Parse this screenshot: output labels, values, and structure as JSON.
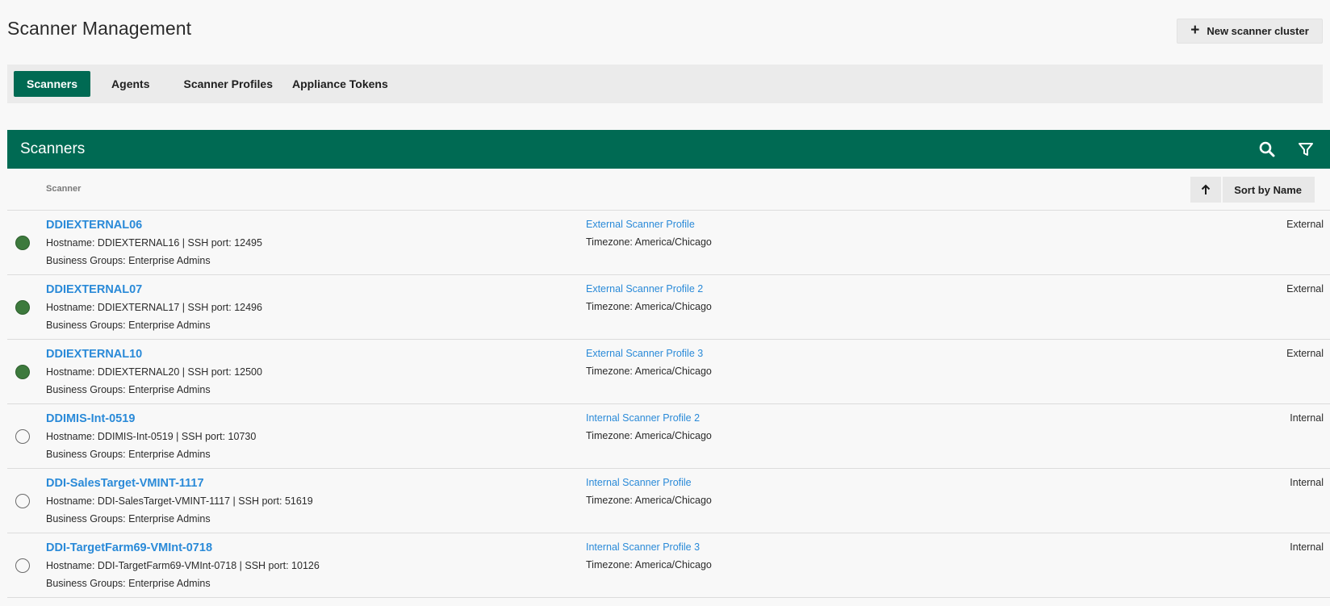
{
  "header": {
    "title": "Scanner Management",
    "new_cluster_label": "New scanner cluster"
  },
  "tabs": [
    {
      "label": "Scanners",
      "active": true
    },
    {
      "label": "Agents",
      "active": false
    },
    {
      "label": "Scanner Profiles",
      "active": false
    },
    {
      "label": "Appliance Tokens",
      "active": false
    }
  ],
  "panel": {
    "title": "Scanners",
    "column_label": "Scanner",
    "sort_label": "Sort by Name",
    "sort_direction": "ascending"
  },
  "colors": {
    "brand_green": "#006a53",
    "link_blue": "#2a8ad8",
    "status_online": "#3d7a3d"
  },
  "scanners": [
    {
      "name": "DDIEXTERNAL06",
      "hostname": "Hostname: DDIEXTERNAL16 | SSH port: 12495",
      "business_groups": "Business Groups: Enterprise Admins",
      "profile": "External Scanner Profile",
      "timezone": "Timezone: America/Chicago",
      "type": "External",
      "status": "online"
    },
    {
      "name": "DDIEXTERNAL07",
      "hostname": "Hostname: DDIEXTERNAL17 | SSH port: 12496",
      "business_groups": "Business Groups: Enterprise Admins",
      "profile": "External Scanner Profile 2",
      "timezone": "Timezone: America/Chicago",
      "type": "External",
      "status": "online"
    },
    {
      "name": "DDIEXTERNAL10",
      "hostname": "Hostname: DDIEXTERNAL20 | SSH port: 12500",
      "business_groups": "Business Groups: Enterprise Admins",
      "profile": "External Scanner Profile 3",
      "timezone": "Timezone: America/Chicago",
      "type": "External",
      "status": "online"
    },
    {
      "name": "DDIMIS-Int-0519",
      "hostname": "Hostname: DDIMIS-Int-0519 | SSH port: 10730",
      "business_groups": "Business Groups: Enterprise Admins",
      "profile": "Internal Scanner Profile 2",
      "timezone": "Timezone: America/Chicago",
      "type": "Internal",
      "status": "offline"
    },
    {
      "name": "DDI-SalesTarget-VMINT-1117",
      "hostname": "Hostname: DDI-SalesTarget-VMINT-1117 | SSH port: 51619",
      "business_groups": "Business Groups: Enterprise Admins",
      "profile": "Internal Scanner Profile",
      "timezone": "Timezone: America/Chicago",
      "type": "Internal",
      "status": "offline"
    },
    {
      "name": "DDI-TargetFarm69-VMInt-0718",
      "hostname": "Hostname: DDI-TargetFarm69-VMInt-0718 | SSH port: 10126",
      "business_groups": "Business Groups: Enterprise Admins",
      "profile": "Internal Scanner Profile 3",
      "timezone": "Timezone: America/Chicago",
      "type": "Internal",
      "status": "offline"
    }
  ]
}
